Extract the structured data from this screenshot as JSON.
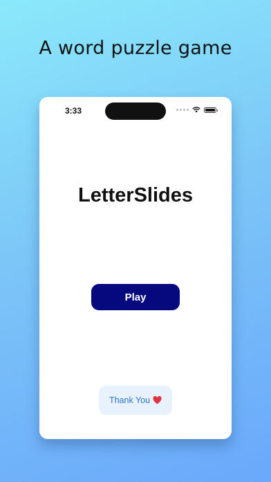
{
  "headline": "A word puzzle game",
  "status_bar": {
    "time": "3:33"
  },
  "app": {
    "title": "LetterSlides",
    "play_label": "Play",
    "thanks_label": "Thank You",
    "thanks_icon": "heart-icon"
  },
  "colors": {
    "play_button": "#06097d",
    "thanks_button_bg": "#e8f2fd",
    "thanks_text": "#2e74c9",
    "heart": "#e0333f"
  }
}
